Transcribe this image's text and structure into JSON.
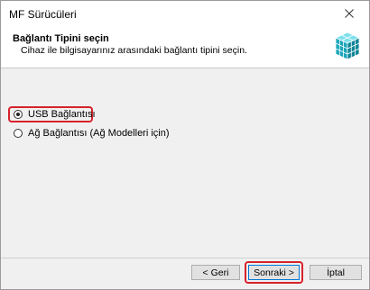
{
  "window": {
    "title": "MF Sürücüleri",
    "close_icon": "close-icon"
  },
  "header": {
    "title": "Bağlantı Tipini seçin",
    "subtitle": "Cihaz ile bilgisayarınız arasındaki bağlantı tipini seçin.",
    "icon": "cube-stack-icon"
  },
  "options": [
    {
      "label": "USB Bağlantısı",
      "selected": true
    },
    {
      "label": "Ağ Bağlantısı (Ağ Modelleri için)",
      "selected": false
    }
  ],
  "buttons": {
    "back": "< Geri",
    "next": "Sonraki >",
    "cancel": "İptal"
  },
  "colors": {
    "highlight": "#d7222b",
    "accent": "#0078d7",
    "cube": "#22b6c8"
  }
}
